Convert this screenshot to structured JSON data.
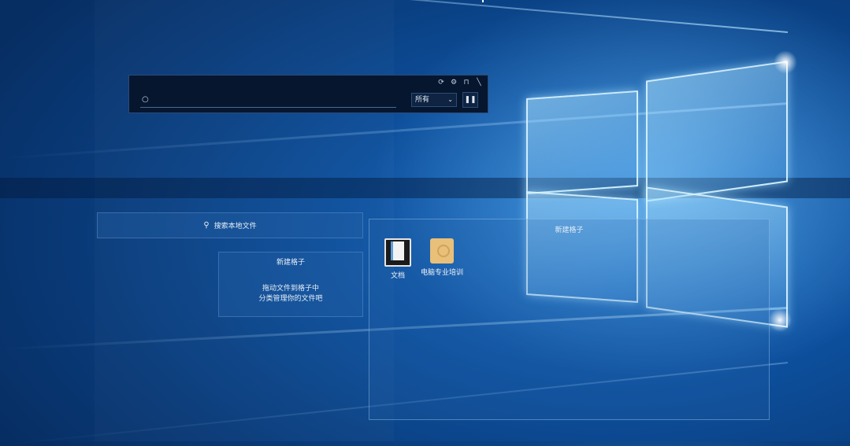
{
  "toolbar": {
    "search_value": "",
    "filter_selected": "所有",
    "window_icons": [
      "refresh-icon",
      "settings-icon",
      "pin-icon",
      "close-icon"
    ]
  },
  "local_search": {
    "placeholder": "搜索本地文件"
  },
  "group_small": {
    "title": "新建格子",
    "hint_line1": "拖动文件到格子中",
    "hint_line2": "分类管理你的文件吧"
  },
  "group_large": {
    "title": "新建格子",
    "files": [
      {
        "name": "文档",
        "icon": "document-icon"
      },
      {
        "name": "电脑专业培训",
        "icon": "folder-icon"
      }
    ]
  },
  "colors": {
    "desktop_blue": "#0d4f9c",
    "toolbar_bg": "#06162e"
  }
}
